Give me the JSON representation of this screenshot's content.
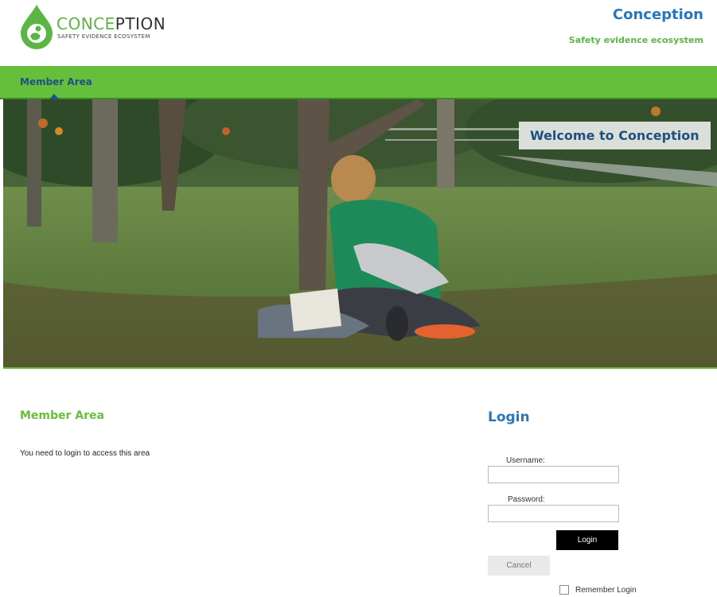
{
  "header": {
    "logo_word_prefix": "CONCE",
    "logo_word_suffix": "PTION",
    "logo_sub": "SAFETY EVIDENCE ECOSYSTEM",
    "brand_title": "Conception",
    "brand_subtitle": "Safety evidence ecosystem"
  },
  "nav": {
    "items": [
      {
        "label": "Member Area",
        "active": true
      }
    ]
  },
  "hero": {
    "welcome": "Welcome to Conception"
  },
  "main": {
    "title": "Member Area",
    "message": "You need to login to access this area"
  },
  "login": {
    "title": "Login",
    "username_label": "Username:",
    "username_value": "",
    "password_label": "Password:",
    "password_value": "",
    "login_button": "Login",
    "cancel_button": "Cancel",
    "remember_label": "Remember Login",
    "remember_checked": false
  },
  "colors": {
    "accent_green": "#66bf3b",
    "accent_blue": "#2676c2",
    "nav_text": "#1f4f83"
  }
}
